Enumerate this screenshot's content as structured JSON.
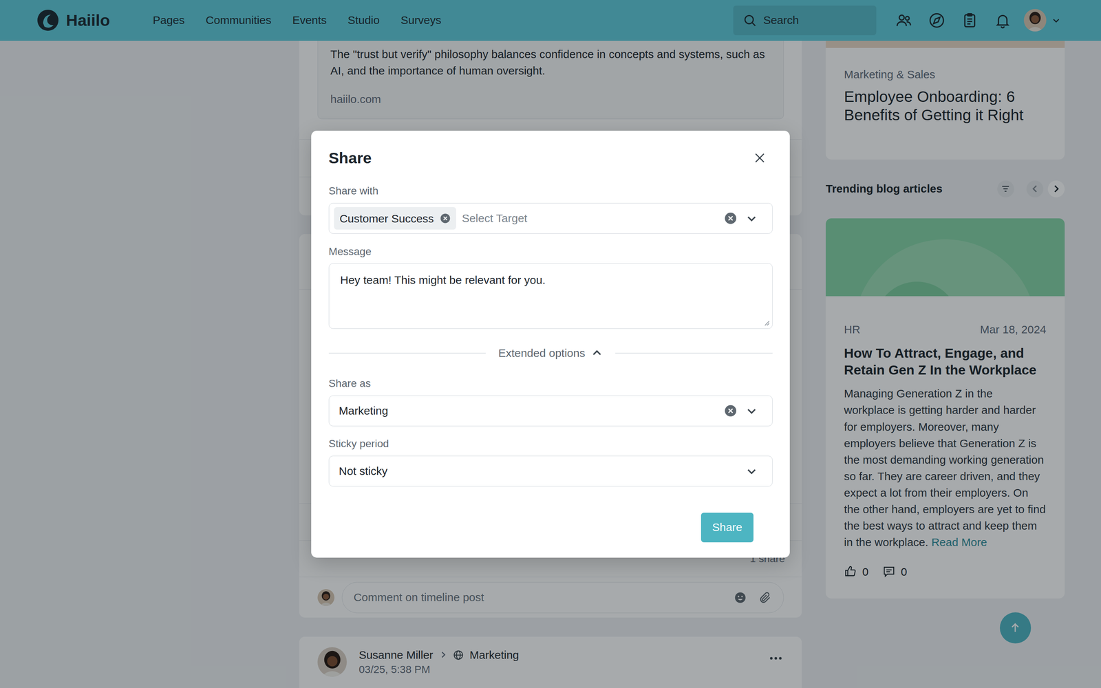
{
  "nav": {
    "logo": "Haiilo",
    "links": [
      "Pages",
      "Communities",
      "Events",
      "Studio",
      "Surveys"
    ],
    "search_placeholder": "Search"
  },
  "feed": {
    "link_preview": {
      "description": "The \"trust but verify\" philosophy balances confidence in concepts and systems, such as AI, and the importance of human oversight.",
      "domain": "haiilo.com"
    },
    "share_count": "1 share",
    "comment_placeholder": "Comment on timeline post",
    "post": {
      "author": "Susanne Miller",
      "target": "Marketing",
      "time": "03/25, 5:38 PM"
    }
  },
  "sidebar": {
    "featured": {
      "category": "Marketing & Sales",
      "title": "Employee Onboarding: 6 Benefits of Getting it Right"
    },
    "trending": {
      "title": "Trending blog articles",
      "article": {
        "category": "HR",
        "date": "Mar 18, 2024",
        "title": "How To Attract, Engage, and Retain Gen Z In the Workplace",
        "excerpt": "Managing Generation Z in the workplace is getting harder and harder for employers. Moreover, many employers believe that Generation Z is the most demanding working generation so far. They are career driven, and they expect a lot from their employers. On the other hand, employers are yet to find the best ways to attract and keep them in the workplace.",
        "read_more": "Read More",
        "likes": "0",
        "comments": "0"
      }
    }
  },
  "modal": {
    "title": "Share",
    "share_with": {
      "label": "Share with",
      "chips": [
        "Customer Success"
      ],
      "placeholder": "Select Target"
    },
    "message": {
      "label": "Message",
      "value": "Hey team! This might be relevant for you."
    },
    "extended": {
      "label": "Extended options",
      "expanded": true
    },
    "share_as": {
      "label": "Share as",
      "value": "Marketing"
    },
    "sticky": {
      "label": "Sticky period",
      "value": "Not sticky"
    },
    "submit": "Share"
  }
}
